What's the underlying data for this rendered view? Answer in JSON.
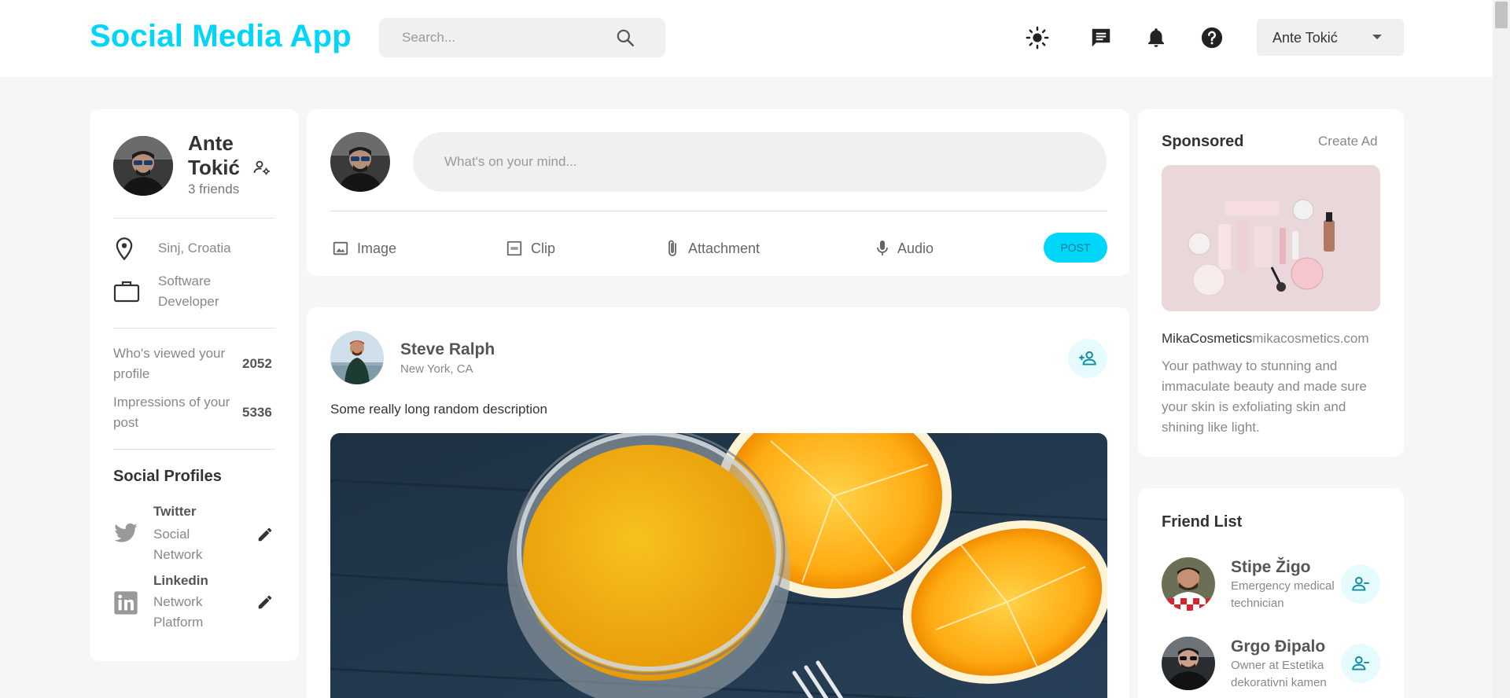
{
  "navbar": {
    "logo": "Social Media App",
    "search_placeholder": "Search...",
    "user_name": "Ante Tokić",
    "icons": [
      "sun-icon",
      "message-icon",
      "bell-icon",
      "help-icon"
    ]
  },
  "profile": {
    "name": "Ante Tokić",
    "friends": "3 friends",
    "location": "Sinj, Croatia",
    "occupation": "Software Developer",
    "stats": [
      {
        "label": "Who's viewed your profile",
        "value": "2052"
      },
      {
        "label": "Impressions of your post",
        "value": "5336"
      }
    ],
    "social_title": "Social Profiles",
    "socials": [
      {
        "name": "Twitter",
        "type": "Social Network",
        "icon": "twitter-icon"
      },
      {
        "name": "Linkedin",
        "type": "Network Platform",
        "icon": "linkedin-icon"
      }
    ]
  },
  "composer": {
    "placeholder": "What's on your mind...",
    "actions": [
      "Image",
      "Clip",
      "Attachment",
      "Audio"
    ],
    "post_label": "POST"
  },
  "post": {
    "author": "Steve Ralph",
    "location": "New York, CA",
    "description": "Some really long random description"
  },
  "sponsored": {
    "title": "Sponsored",
    "create_ad": "Create Ad",
    "brand": "MikaCosmetics",
    "site": "mikacosmetics.com",
    "description": "Your pathway to stunning and immaculate beauty and made sure your skin is exfoliating skin and shining like light."
  },
  "friend_list": {
    "title": "Friend List",
    "friends": [
      {
        "name": "Stipe Žigo",
        "subtitle": "Emergency medical technician"
      },
      {
        "name": "Grgo Đipalo",
        "subtitle": "Owner at Estetika dekorativni kamen"
      }
    ]
  },
  "colors": {
    "accent": "#00d5fa",
    "background": "#f6f6f6",
    "card": "#ffffff"
  }
}
